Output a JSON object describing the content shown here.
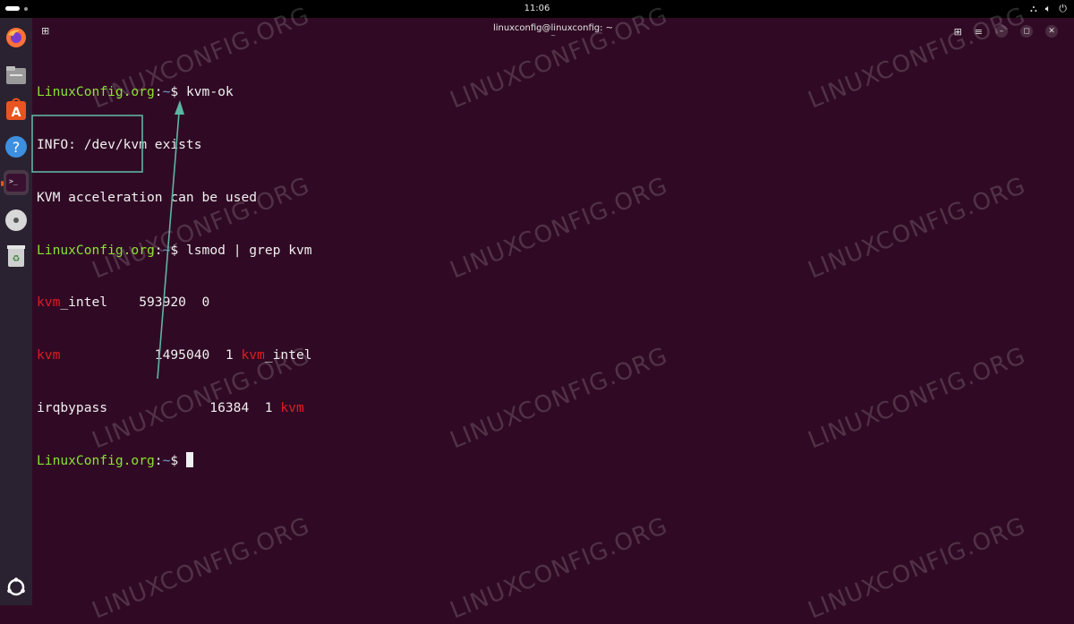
{
  "topbar": {
    "clock": "11:06"
  },
  "window": {
    "title": "linuxconfig@linuxconfig: ~",
    "subtitle": "~"
  },
  "dock": {
    "items": [
      "firefox-icon",
      "files-icon",
      "app-center-icon",
      "help-icon",
      "terminal-icon",
      "disc-icon",
      "trash-icon"
    ],
    "apps_grid": "ubuntu-apps-icon"
  },
  "terminal": {
    "prompt_user": "LinuxConfig.org",
    "prompt_sep": ":",
    "prompt_path": "~",
    "prompt_dollar": "$",
    "cmd1": " kvm-ok",
    "out1": "INFO: /dev/kvm exists",
    "out2": "KVM acceleration can be used",
    "cmd2": " lsmod | grep kvm",
    "rows": [
      {
        "name_red": "kvm",
        "name_rest": "_intel",
        "size": "    593920  0",
        "used_red": "",
        "used_rest": ""
      },
      {
        "name_red": "kvm",
        "name_rest": "",
        "size": "            1495040  1 ",
        "used_red": "kvm",
        "used_rest": "_intel"
      },
      {
        "name_red": "",
        "name_rest": "irqbypass",
        "size": "             16384  1 ",
        "used_red": "kvm",
        "used_rest": ""
      }
    ]
  },
  "watermark": "LINUXCONFIG.ORG",
  "colors": {
    "background": "#300a24",
    "prompt_user": "#8ae234",
    "prompt_path": "#729fcf",
    "highlight": "#e01b24",
    "annotation": "#5fb3a3"
  }
}
